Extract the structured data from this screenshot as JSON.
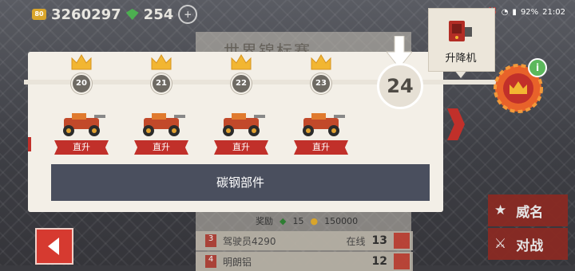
{
  "hud": {
    "coins": "3260297",
    "coin_icon_label": "80",
    "gems": "254"
  },
  "status_bar": {
    "battery": "92%",
    "time": "21:02"
  },
  "background": {
    "title": "世界锦标赛",
    "reward_gems": "15",
    "reward_coins": "150000",
    "reward_label": "奖励",
    "rows": [
      {
        "rank": "3",
        "name": "驾驶员4290",
        "status": "在线",
        "score": "13"
      },
      {
        "rank": "4",
        "name": "明朗铝",
        "status": "",
        "score": "12"
      }
    ]
  },
  "track": {
    "nodes": [
      "20",
      "21",
      "22",
      "23"
    ],
    "current": "24"
  },
  "rewards": [
    {
      "label": "直升",
      "icon": "car-icon"
    },
    {
      "label": "直升",
      "icon": "car-icon"
    },
    {
      "label": "直升",
      "icon": "car-icon"
    },
    {
      "label": "直升",
      "icon": "car-icon"
    }
  ],
  "reward_bar": "碳钢部件",
  "lift": {
    "label": "升降机",
    "icon": "lift-icon"
  },
  "side_buttons": [
    {
      "label": "威名",
      "icon": "star-icon"
    },
    {
      "label": "对战",
      "icon": "swords-icon"
    }
  ],
  "colors": {
    "accent_red": "#c1302a",
    "card_bg": "#f3efe7",
    "bar_bg": "#4a4f5e",
    "crown_gold": "#f2b632",
    "gem_green": "#4caf50"
  }
}
